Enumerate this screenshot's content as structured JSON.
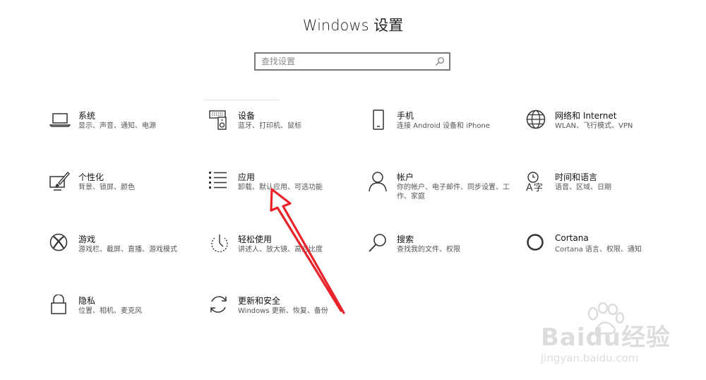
{
  "header": {
    "title": "Windows 设置"
  },
  "search": {
    "placeholder": "查找设置",
    "icon": "search-icon"
  },
  "tiles": [
    {
      "name": "系统",
      "desc": "显示、声音、通知、电源",
      "icon": "laptop-icon"
    },
    {
      "name": "设备",
      "desc": "蓝牙、打印机、鼠标",
      "icon": "keyboard-speaker-icon"
    },
    {
      "name": "手机",
      "desc": "连接 Android 设备和 iPhone",
      "icon": "phone-icon"
    },
    {
      "name": "网络和 Internet",
      "desc": "WLAN、飞行模式、VPN",
      "icon": "globe-icon"
    },
    {
      "name": "个性化",
      "desc": "背景、锁屏、颜色",
      "icon": "paint-brush-icon"
    },
    {
      "name": "应用",
      "desc": "卸载、默认应用、可选功能",
      "icon": "apps-list-icon"
    },
    {
      "name": "帐户",
      "desc": "你的帐户、电子邮件、同步设置、工作、家庭",
      "icon": "person-icon"
    },
    {
      "name": "时间和语言",
      "desc": "语音、区域、日期",
      "icon": "time-language-icon"
    },
    {
      "name": "游戏",
      "desc": "游戏栏、截屏、直播、游戏模式",
      "icon": "xbox-icon"
    },
    {
      "name": "轻松使用",
      "desc": "讲述人、放大镜、高对比度",
      "icon": "ease-of-access-icon"
    },
    {
      "name": "搜索",
      "desc": "查找我的文件、权限",
      "icon": "magnifier-icon"
    },
    {
      "name": "Cortana",
      "desc": "Cortana 语言、权限、通知",
      "icon": "cortana-icon"
    },
    {
      "name": "隐私",
      "desc": "位置、相机、麦克风",
      "icon": "lock-icon"
    },
    {
      "name": "更新和安全",
      "desc": "Windows 更新、恢复、备份",
      "icon": "sync-icon"
    }
  ],
  "watermark": {
    "brand": "Baidu经验",
    "url": "jingyan.baidu.com"
  },
  "colors": {
    "arrow": "#e8232a",
    "text": "#1a1a1a",
    "secondary_text": "#555555",
    "border": "#7a7a7a"
  }
}
